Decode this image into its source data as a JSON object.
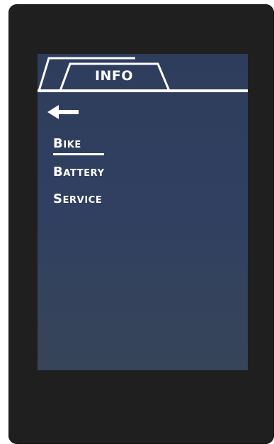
{
  "header": {
    "tab_label": "INFO"
  },
  "nav": {
    "back_icon": "arrow-left-icon"
  },
  "menu": {
    "items": [
      {
        "label": "Bike",
        "selected": true
      },
      {
        "label": "Battery",
        "selected": false
      },
      {
        "label": "Service",
        "selected": false
      }
    ]
  },
  "colors": {
    "screen_bg": "#314060",
    "device_bezel": "#1f1f1f",
    "foreground": "#ffffff"
  }
}
